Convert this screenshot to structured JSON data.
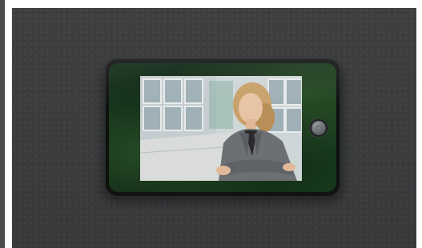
{
  "scene": {
    "subject": "door-peephole-viewer",
    "wall_color": "#3b3d3f",
    "device_color": "#111312",
    "screen_content": "businesswoman-photo"
  }
}
